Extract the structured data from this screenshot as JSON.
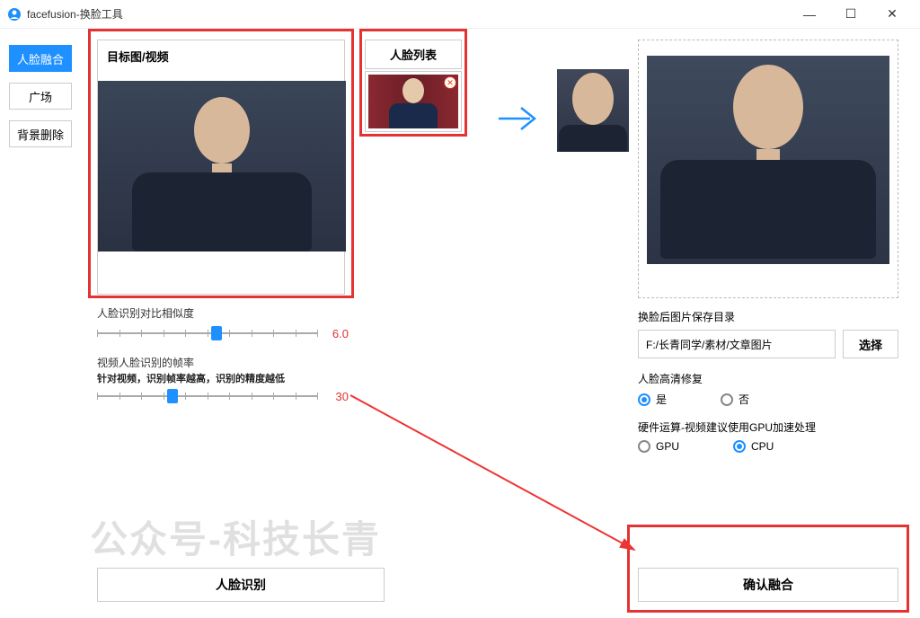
{
  "window": {
    "title": "facefusion-换脸工具"
  },
  "sidebar": {
    "items": [
      {
        "label": "人脸融合",
        "active": true
      },
      {
        "label": "广场",
        "active": false
      },
      {
        "label": "背景删除",
        "active": false
      }
    ]
  },
  "target_panel": {
    "header": "目标图/视频"
  },
  "face_list": {
    "header": "人脸列表"
  },
  "sliders": {
    "similarity": {
      "label": "人脸识别对比相似度",
      "value": "6.0",
      "percent": 54
    },
    "fps": {
      "label": "视频人脸识别的帧率",
      "hint": "针对视频，识别帧率越高，识别的精度越低",
      "value": "30",
      "percent": 34
    }
  },
  "output": {
    "path_label": "换脸后图片保存目录",
    "path_value": "F:/长青同学/素材/文章图片",
    "browse_label": "选择"
  },
  "hd_repair": {
    "label": "人脸高清修复",
    "yes": "是",
    "no": "否",
    "selected": "yes"
  },
  "hardware": {
    "label": "硬件运算-视频建议使用GPU加速处理",
    "gpu": "GPU",
    "cpu": "CPU",
    "selected": "cpu"
  },
  "buttons": {
    "recognize": "人脸识别",
    "confirm": "确认融合"
  },
  "watermark": "公众号-科技长青"
}
